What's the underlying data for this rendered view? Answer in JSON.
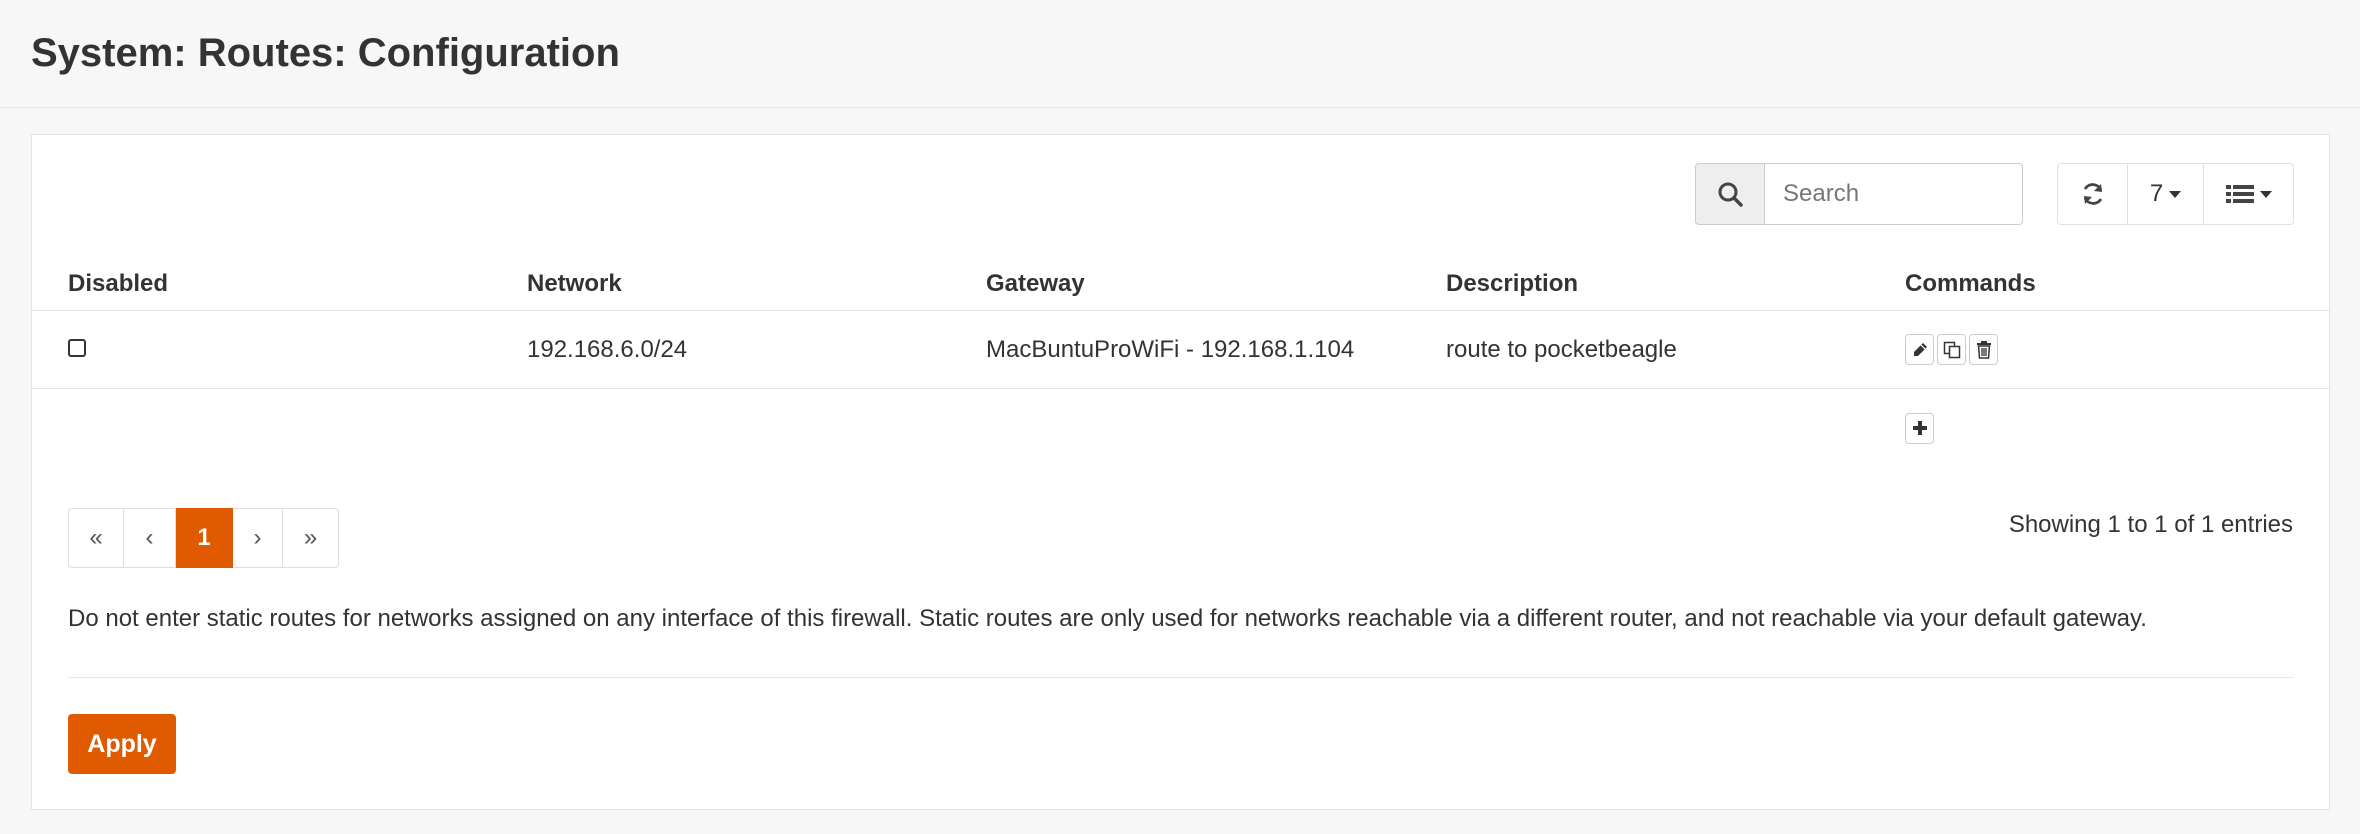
{
  "page": {
    "title": "System: Routes: Configuration"
  },
  "toolbar": {
    "search_placeholder": "Search",
    "rows_per_page": "7",
    "refresh_icon": "refresh-icon",
    "columns_icon": "list-icon"
  },
  "table": {
    "columns": [
      "Disabled",
      "Network",
      "Gateway",
      "Description",
      "Commands"
    ],
    "rows": [
      {
        "disabled": false,
        "network": "192.168.6.0/24",
        "gateway": "MacBuntuProWiFi - 192.168.1.104",
        "description": "route to pocketbeagle",
        "commands": [
          "pencil-icon",
          "copy-icon",
          "trash-icon"
        ]
      }
    ],
    "add_icon": "plus-icon"
  },
  "pagination": {
    "first": "«",
    "prev": "‹",
    "current": "1",
    "next": "›",
    "last": "»",
    "summary": "Showing 1 to 1 of 1 entries"
  },
  "note": "Do not enter static routes for networks assigned on any interface of this firewall. Static routes are only used for networks reachable via a different router, and not reachable via your default gateway.",
  "actions": {
    "apply_label": "Apply"
  },
  "colors": {
    "accent": "#e05a00",
    "background": "#f7f7f7",
    "border": "#e6e6e6"
  }
}
